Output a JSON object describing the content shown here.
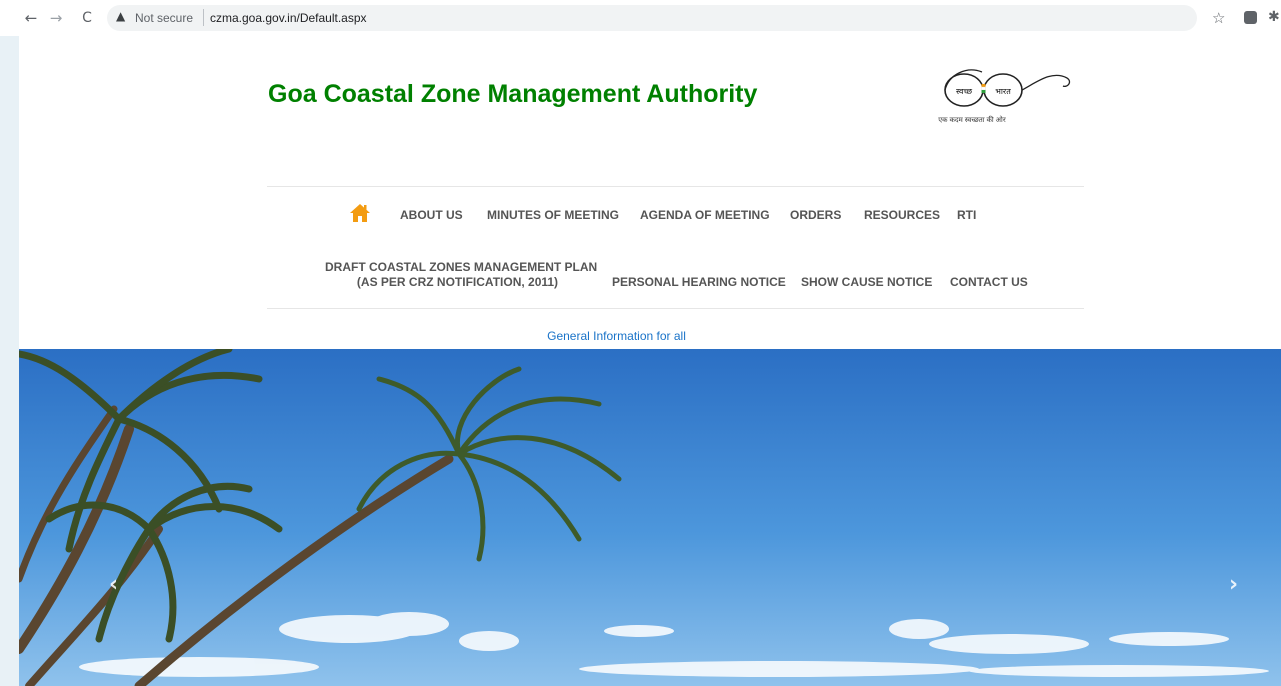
{
  "browser": {
    "security_label": "Not secure",
    "url": "czma.goa.gov.in/Default.aspx"
  },
  "site": {
    "title": "Goa Coastal Zone Management Authority",
    "logo_text_left": "स्वच्छ",
    "logo_text_right": "भारत",
    "logo_tagline": "एक कदम स्वच्छता की ओर"
  },
  "nav": {
    "home_icon": "home-icon",
    "row1": [
      "ABOUT US",
      "MINUTES OF MEETING",
      "AGENDA OF MEETING",
      "ORDERS",
      "RESOURCES",
      "RTI"
    ],
    "row2": {
      "draft_line1": "DRAFT COASTAL ZONES MANAGEMENT PLAN",
      "draft_line2": "(AS PER CRZ NOTIFICATION, 2011)",
      "hearing": "PERSONAL HEARING NOTICE",
      "show_cause": "SHOW CAUSE NOTICE",
      "contact": "CONTACT US"
    }
  },
  "general_info": "General Information for all",
  "colors": {
    "title_green": "#008000",
    "home_orange": "#f39c12",
    "link_blue": "#1a73c8",
    "menu_text": "#555555"
  }
}
